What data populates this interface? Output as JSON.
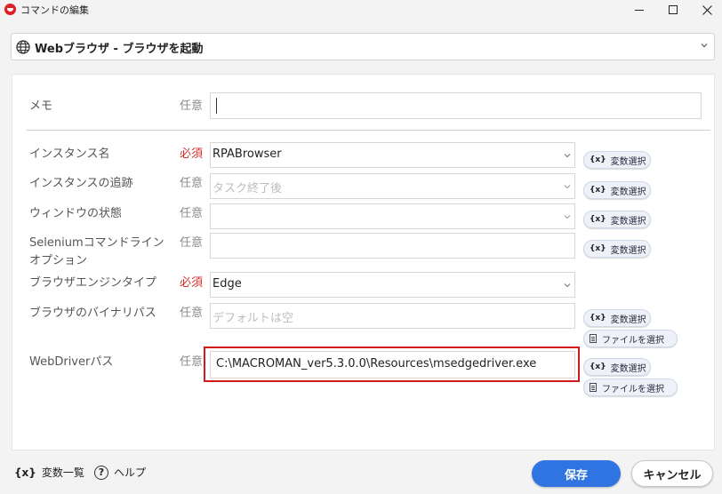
{
  "window": {
    "title": "コマンドの編集",
    "app_icon": "app-logo-icon"
  },
  "command": {
    "label": "Webブラウザ - ブラウザを起動",
    "icon": "globe-icon"
  },
  "form": {
    "memo": {
      "label": "メモ",
      "req": "任意",
      "value": ""
    },
    "instance_name": {
      "label": "インスタンス名",
      "req": "必須",
      "value": "RPABrowser",
      "var_button": "変数選択"
    },
    "instance_tracking": {
      "label": "インスタンスの追跡",
      "req": "任意",
      "placeholder": "タスク終了後",
      "var_button": "変数選択"
    },
    "window_state": {
      "label": "ウィンドウの状態",
      "req": "任意",
      "value": "",
      "var_button": "変数選択"
    },
    "selenium_options": {
      "label_line1": "Seleniumコマンドライン",
      "label_line2": "オプション",
      "req": "任意",
      "value": "",
      "var_button": "変数選択"
    },
    "engine_type": {
      "label": "ブラウザエンジンタイプ",
      "req": "必須",
      "value": "Edge"
    },
    "binary_path": {
      "label": "ブラウザのバイナリパス",
      "req": "任意",
      "placeholder": "デフォルトは空",
      "var_button": "変数選択",
      "file_button": "ファイルを選択"
    },
    "webdriver_path": {
      "label": "WebDriverパス",
      "req": "任意",
      "value": "C:\\MACROMAN_ver5.3.0.0\\Resources\\msedgedriver.exe",
      "var_button": "変数選択",
      "file_button": "ファイルを選択"
    }
  },
  "var_icon_text": "{x}",
  "footer": {
    "var_list_icon": "{x}",
    "var_list": "変数一覧",
    "help_icon": "?",
    "help": "ヘルプ",
    "save": "保存",
    "cancel": "キャンセル"
  },
  "colors": {
    "primary": "#2f74e0",
    "required": "#d32f2f",
    "highlight": "#d11a1a"
  }
}
